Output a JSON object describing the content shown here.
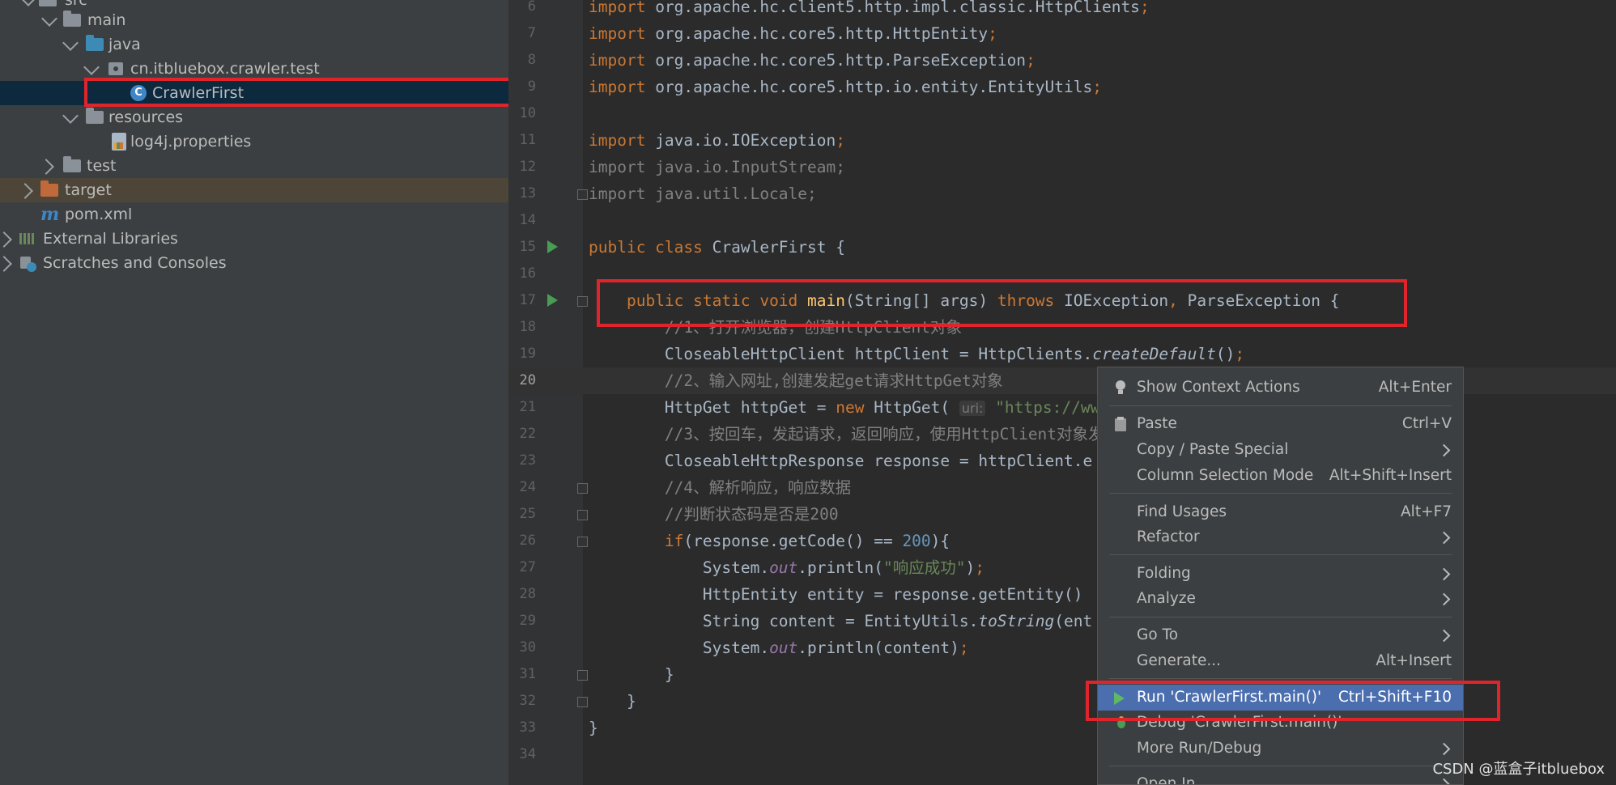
{
  "project_tree": {
    "items": [
      {
        "label": "src"
      },
      {
        "label": "main"
      },
      {
        "label": "java"
      },
      {
        "label": "cn.itbluebox.crawler.test"
      },
      {
        "label": "CrawlerFirst"
      },
      {
        "label": "resources"
      },
      {
        "label": "log4j.properties"
      },
      {
        "label": "test"
      },
      {
        "label": "target"
      },
      {
        "label": "pom.xml"
      },
      {
        "label": "External Libraries"
      },
      {
        "label": "Scratches and Consoles"
      }
    ]
  },
  "editor": {
    "lines": [
      {
        "n": "6",
        "parts": [
          [
            "kw",
            "import "
          ],
          [
            "pl",
            "org.apache.hc.client5.http.impl.classic.HttpClients"
          ],
          [
            "kw",
            ";"
          ]
        ]
      },
      {
        "n": "7",
        "parts": [
          [
            "kw",
            "import "
          ],
          [
            "pl",
            "org.apache.hc.core5.http.HttpEntity"
          ],
          [
            "kw",
            ";"
          ]
        ]
      },
      {
        "n": "8",
        "parts": [
          [
            "kw",
            "import "
          ],
          [
            "pl",
            "org.apache.hc.core5.http.ParseException"
          ],
          [
            "kw",
            ";"
          ]
        ]
      },
      {
        "n": "9",
        "parts": [
          [
            "kw",
            "import "
          ],
          [
            "pl",
            "org.apache.hc.core5.http.io.entity.EntityUtils"
          ],
          [
            "kw",
            ";"
          ]
        ]
      },
      {
        "n": "10",
        "parts": []
      },
      {
        "n": "11",
        "parts": [
          [
            "kw",
            "import "
          ],
          [
            "pl",
            "java.io.IOException"
          ],
          [
            "kw",
            ";"
          ]
        ]
      },
      {
        "n": "12",
        "parts": [
          [
            "unused",
            "import java.io.InputStream;"
          ]
        ]
      },
      {
        "n": "13",
        "parts": [
          [
            "unused",
            "import java.util.Locale;"
          ]
        ]
      },
      {
        "n": "14",
        "parts": []
      },
      {
        "n": "15",
        "parts": [
          [
            "kw",
            "public class "
          ],
          [
            "pl",
            "CrawlerFirst {"
          ]
        ]
      },
      {
        "n": "16",
        "parts": []
      },
      {
        "n": "17",
        "parts": [
          [
            "pl",
            "    "
          ],
          [
            "kw",
            "public static void "
          ],
          [
            "fn",
            "main"
          ],
          [
            "pl",
            "(String[] args) "
          ],
          [
            "kw",
            "throws "
          ],
          [
            "pl",
            "IOException"
          ],
          [
            "kw",
            ", "
          ],
          [
            "pl",
            "ParseException {"
          ]
        ]
      },
      {
        "n": "18",
        "parts": [
          [
            "cm",
            "        //1、打开浏览器，创建HttpClient对象"
          ]
        ]
      },
      {
        "n": "19",
        "parts": [
          [
            "pl",
            "        CloseableHttpClient httpClient = HttpClients."
          ],
          [
            "it",
            "createDefault"
          ],
          [
            "pl",
            "()"
          ],
          [
            "kw",
            ";"
          ]
        ]
      },
      {
        "n": "20",
        "parts": [
          [
            "cm",
            "        //2、输入网址,创建发起get请求HttpGet对象"
          ]
        ]
      },
      {
        "n": "21",
        "parts": [
          [
            "pl",
            "        HttpGet httpGet = "
          ],
          [
            "kw",
            "new "
          ],
          [
            "pl",
            "HttpGet( "
          ],
          [
            "hint",
            "uri:"
          ],
          [
            "str",
            " \"https://ww"
          ]
        ]
      },
      {
        "n": "22",
        "parts": [
          [
            "cm",
            "        //3、按回车，发起请求，返回响应，使用HttpClient对象发"
          ]
        ]
      },
      {
        "n": "23",
        "parts": [
          [
            "pl",
            "        CloseableHttpResponse response = httpClient.e"
          ]
        ]
      },
      {
        "n": "24",
        "parts": [
          [
            "cm",
            "        //4、解析响应，响应数据"
          ]
        ]
      },
      {
        "n": "25",
        "parts": [
          [
            "cm",
            "        //判断状态码是否是200"
          ]
        ]
      },
      {
        "n": "26",
        "parts": [
          [
            "pl",
            "        "
          ],
          [
            "kw",
            "if"
          ],
          [
            "pl",
            "(response.getCode() == "
          ],
          [
            "num",
            "200"
          ],
          [
            "pl",
            "){"
          ]
        ]
      },
      {
        "n": "27",
        "parts": [
          [
            "pl",
            "            System."
          ],
          [
            "st",
            "out"
          ],
          [
            "pl",
            ".println("
          ],
          [
            "str",
            "\"响应成功\""
          ],
          [
            "pl",
            ")"
          ],
          [
            "kw",
            ";"
          ]
        ]
      },
      {
        "n": "28",
        "parts": [
          [
            "pl",
            "            HttpEntity entity = response.getEntity()"
          ]
        ]
      },
      {
        "n": "29",
        "parts": [
          [
            "pl",
            "            String content = EntityUtils."
          ],
          [
            "it",
            "toString"
          ],
          [
            "pl",
            "(ent"
          ]
        ]
      },
      {
        "n": "30",
        "parts": [
          [
            "pl",
            "            System."
          ],
          [
            "st",
            "out"
          ],
          [
            "pl",
            ".println(content)"
          ],
          [
            "kw",
            ";"
          ]
        ]
      },
      {
        "n": "31",
        "parts": [
          [
            "pl",
            "        }"
          ]
        ]
      },
      {
        "n": "32",
        "parts": [
          [
            "pl",
            "    }"
          ]
        ]
      },
      {
        "n": "33",
        "parts": [
          [
            "pl",
            "}"
          ]
        ]
      },
      {
        "n": "34",
        "parts": []
      }
    ]
  },
  "context_menu": {
    "show_context_actions": {
      "label": "Show Context Actions",
      "shortcut": "Alt+Enter"
    },
    "paste": {
      "label": "Paste",
      "shortcut": "Ctrl+V"
    },
    "copy_paste_special": {
      "label": "Copy / Paste Special"
    },
    "column_selection_mode": {
      "label": "Column Selection Mode",
      "shortcut": "Alt+Shift+Insert"
    },
    "find_usages": {
      "label": "Find Usages",
      "shortcut": "Alt+F7"
    },
    "refactor": {
      "label": "Refactor"
    },
    "folding": {
      "label": "Folding"
    },
    "analyze": {
      "label": "Analyze"
    },
    "go_to": {
      "label": "Go To"
    },
    "generate": {
      "label": "Generate...",
      "shortcut": "Alt+Insert"
    },
    "run": {
      "label": "Run 'CrawlerFirst.main()'",
      "shortcut": "Ctrl+Shift+F10"
    },
    "debug": {
      "label": "Debug 'CrawlerFirst.main()'"
    },
    "more_run_debug": {
      "label": "More Run/Debug"
    },
    "open_in": {
      "label": "Open In"
    }
  },
  "watermark": "CSDN @蓝盒子itbluebox",
  "colors": {
    "highlight_box": "#e0242c",
    "menu_active": "#4b6eaf",
    "run_green": "#499c54"
  }
}
